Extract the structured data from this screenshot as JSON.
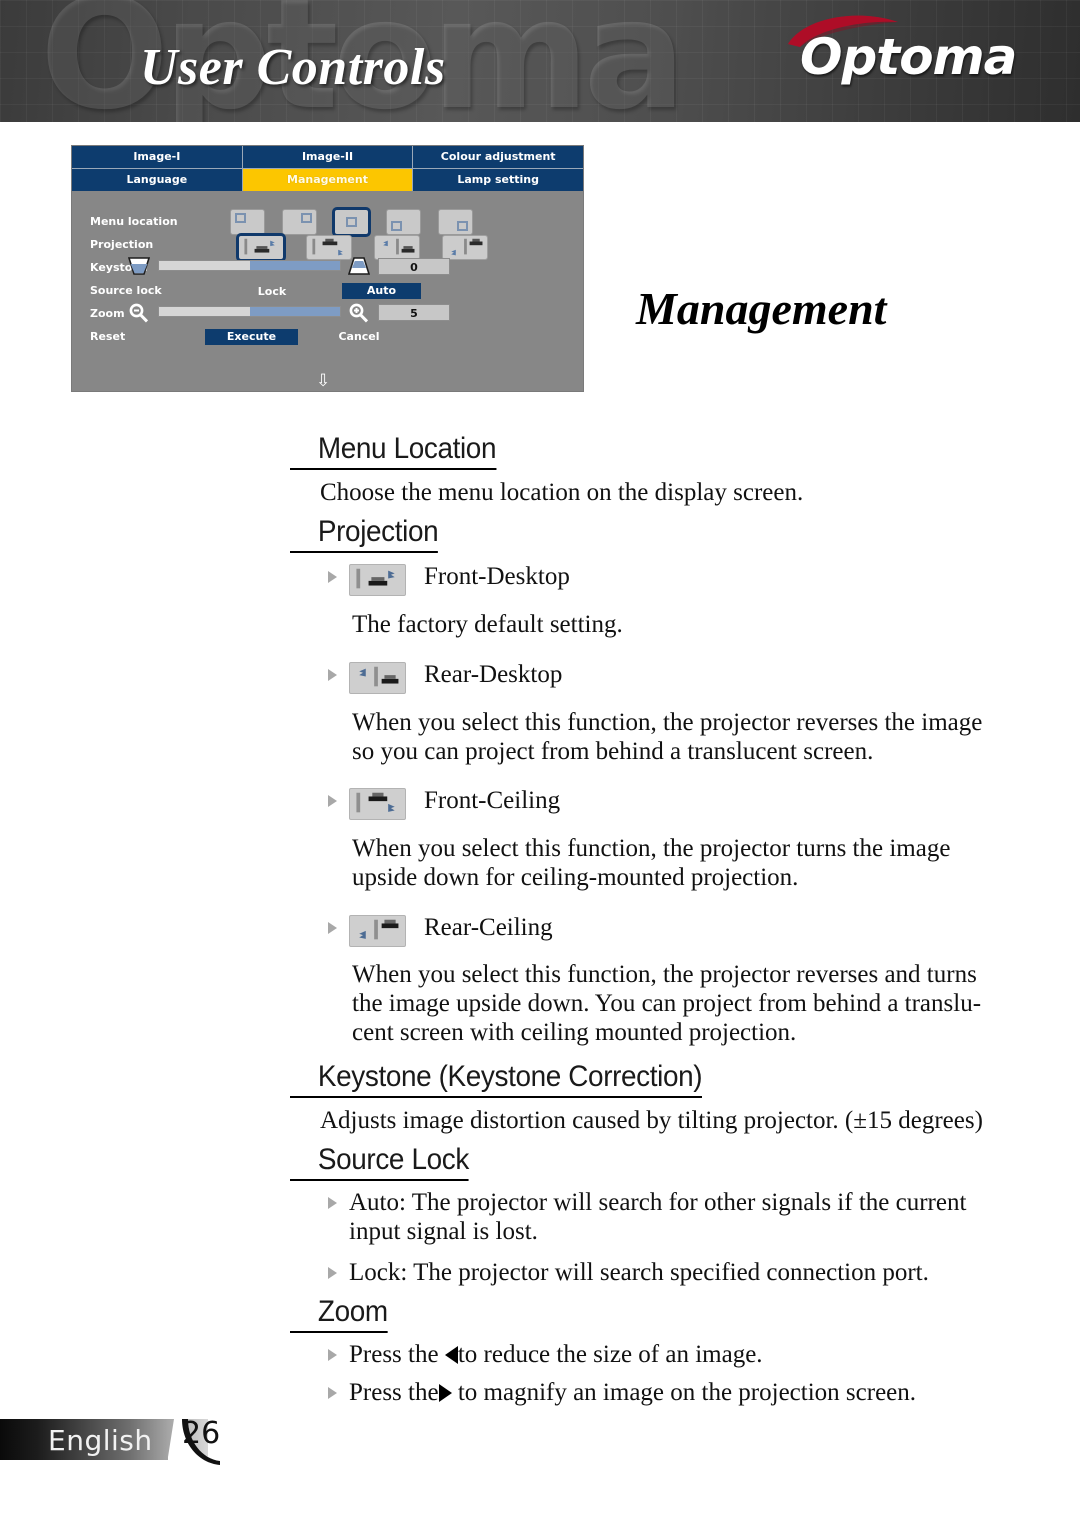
{
  "header": {
    "title": "User Controls",
    "ghost_wordmark": "Optoma",
    "logo_text": "Optoma",
    "logo_swoosh_color": "#c8102e"
  },
  "osd": {
    "tabs_row1": [
      {
        "label": "Image-I",
        "active": false
      },
      {
        "label": "Image-II",
        "active": false
      },
      {
        "label": "Colour adjustment",
        "active": false
      }
    ],
    "tabs_row2": [
      {
        "label": "Language",
        "active": false
      },
      {
        "label": "Management",
        "active": true
      },
      {
        "label": "Lamp setting",
        "active": false
      }
    ],
    "rows": [
      {
        "label": "Menu location"
      },
      {
        "label": "Projection"
      },
      {
        "label": "Keystone"
      },
      {
        "label": "Source lock"
      },
      {
        "label": "Zoom"
      },
      {
        "label": "Reset"
      }
    ],
    "menu_location_selected_index": 2,
    "projection_selected_index": 0,
    "keystone": {
      "value": "0",
      "fill_percent": 50
    },
    "zoom": {
      "value": "5",
      "fill_percent": 50
    },
    "source_lock": {
      "lock_label": "Lock",
      "auto_label": "Auto",
      "selected": "Auto"
    },
    "reset": {
      "execute_label": "Execute",
      "cancel_label": "Cancel",
      "selected": "Execute"
    },
    "scroll_hint": "⇩",
    "colors": {
      "tab_blue": "#0d3c6e",
      "tab_active_yellow": "#fcc600",
      "panel_gray": "#878787",
      "slider_fill": "#7e9cc4"
    }
  },
  "page_title": "Management",
  "sections": {
    "menu_location": {
      "heading": "Menu Location",
      "body": "Choose the menu location on the display screen."
    },
    "projection": {
      "heading": "Projection",
      "items": [
        {
          "icon": "front-desktop-icon",
          "label": "Front-Desktop",
          "body": "The factory default setting."
        },
        {
          "icon": "rear-desktop-icon",
          "label": "Rear-Desktop",
          "body": "When you select this function, the projector reverses the image\nso you can project from behind a translucent screen."
        },
        {
          "icon": "front-ceiling-icon",
          "label": "Front-Ceiling",
          "body": "When you select this function, the projector turns the image\nupside down for ceiling-mounted projection."
        },
        {
          "icon": "rear-ceiling-icon",
          "label": "Rear-Ceiling",
          "body": "When you select this function, the projector reverses and turns\nthe image upside down. You can project from behind a translu-\ncent screen with ceiling mounted projection."
        }
      ]
    },
    "keystone": {
      "heading": "Keystone (Keystone Correction)",
      "body": "Adjusts image distortion caused by tilting projector. (±15 degrees)"
    },
    "source_lock": {
      "heading": "Source Lock",
      "bullets": [
        "Auto: The projector will search for other signals if the current\ninput signal is lost.",
        "Lock: The projector will search specified connection port."
      ]
    },
    "zoom": {
      "heading": "Zoom",
      "bullets": [
        {
          "pre": "Press the ",
          "arrow": "arrow-left",
          "post": "to reduce the size of an image."
        },
        {
          "pre": "Press the",
          "arrow": "arrow-right",
          "post": " to magnify an image on the projection screen."
        }
      ]
    }
  },
  "footer": {
    "language": "English",
    "page_number": "26"
  }
}
